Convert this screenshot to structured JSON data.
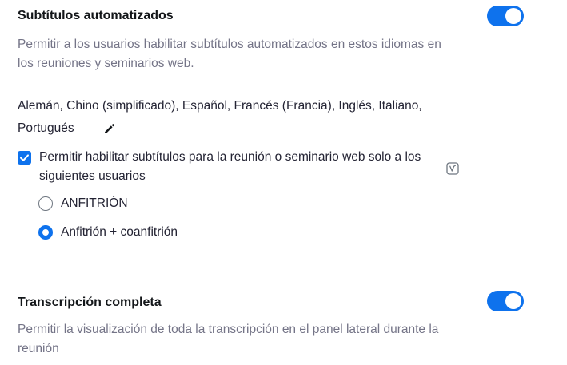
{
  "auto_captions": {
    "title": "Subtítulos automatizados",
    "description": "Permitir a los usuarios habilitar subtítulos automatizados en estos idiomas en los reuniones y seminarios web.",
    "toggle_on": true,
    "languages_line1": "Alemán,  Chino (simplificado),  Español,  Francés (Francia),  Inglés,  Italiano,",
    "languages_line2": "Portugués",
    "restrict_checkbox": {
      "checked": true,
      "label": "Permitir habilitar subtítulos para la reunión o seminario web solo a los siguientes usuarios"
    },
    "user_options": [
      {
        "label": "ANFITRIÓN",
        "selected": false
      },
      {
        "label": "Anfitrión + coanfitrión",
        "selected": true
      }
    ]
  },
  "full_transcript": {
    "title": "Transcripción completa",
    "description": "Permitir la visualización de toda la transcripción en el panel lateral durante la reunión",
    "toggle_on": true
  },
  "colors": {
    "accent": "#0e72ed",
    "title": "#131619",
    "description": "#747487"
  },
  "icons": [
    "pencil-icon",
    "check-icon",
    "info-icon"
  ]
}
